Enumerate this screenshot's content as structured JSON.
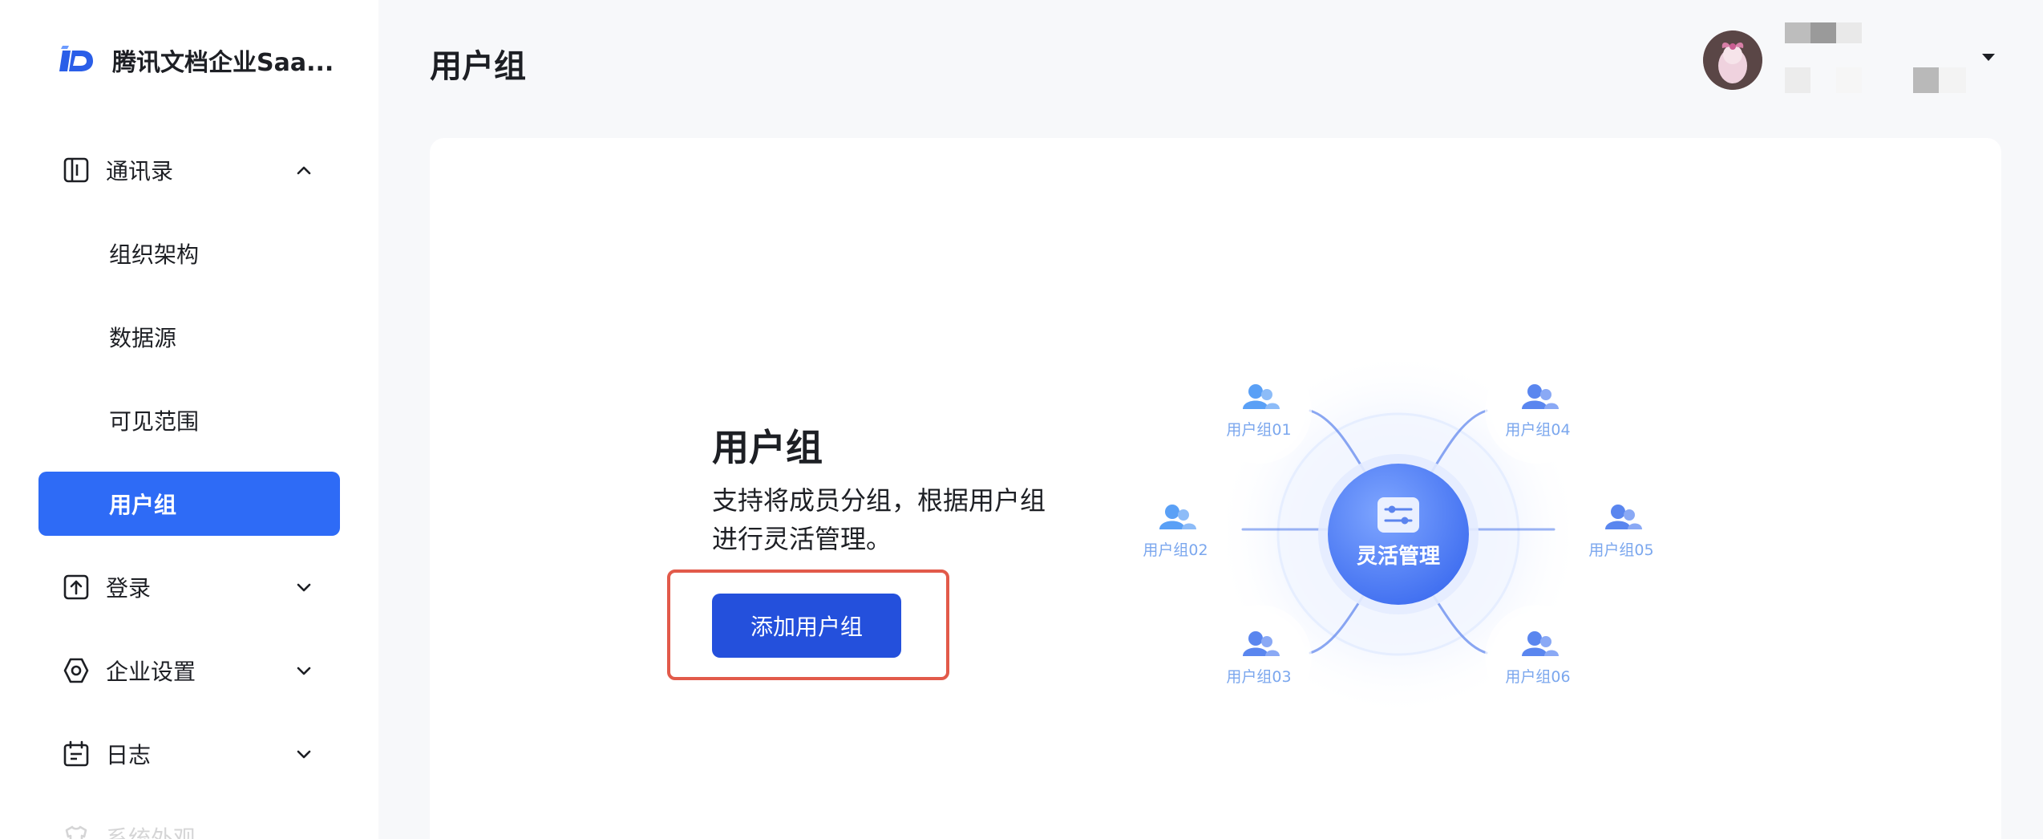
{
  "brand": {
    "name": "腾讯文档企业Saa..."
  },
  "header": {
    "title": "用户组"
  },
  "sidebar": {
    "items": [
      {
        "label": "通讯录",
        "icon": "contacts-icon",
        "expanded": true
      },
      {
        "label": "组织架构"
      },
      {
        "label": "数据源"
      },
      {
        "label": "可见范围"
      },
      {
        "label": "用户组",
        "active": true
      },
      {
        "label": "登录",
        "icon": "login-icon",
        "expanded": false
      },
      {
        "label": "企业设置",
        "icon": "settings-icon",
        "expanded": false
      },
      {
        "label": "日志",
        "icon": "calendar-icon",
        "expanded": false
      },
      {
        "label": "系统外观",
        "icon": "appearance-icon"
      }
    ]
  },
  "main": {
    "heading": "用户组",
    "description": "支持将成员分组，根据用户组进行灵活管理。",
    "add_button": "添加用户组"
  },
  "illustration": {
    "center_label": "灵活管理",
    "groups": [
      "用户组01",
      "用户组04",
      "用户组02",
      "用户组05",
      "用户组03",
      "用户组06"
    ]
  },
  "colors": {
    "primary": "#2E6BF6",
    "button": "#2450DC",
    "highlight": "#E25A4A",
    "group_label": "#7BA7EE"
  }
}
